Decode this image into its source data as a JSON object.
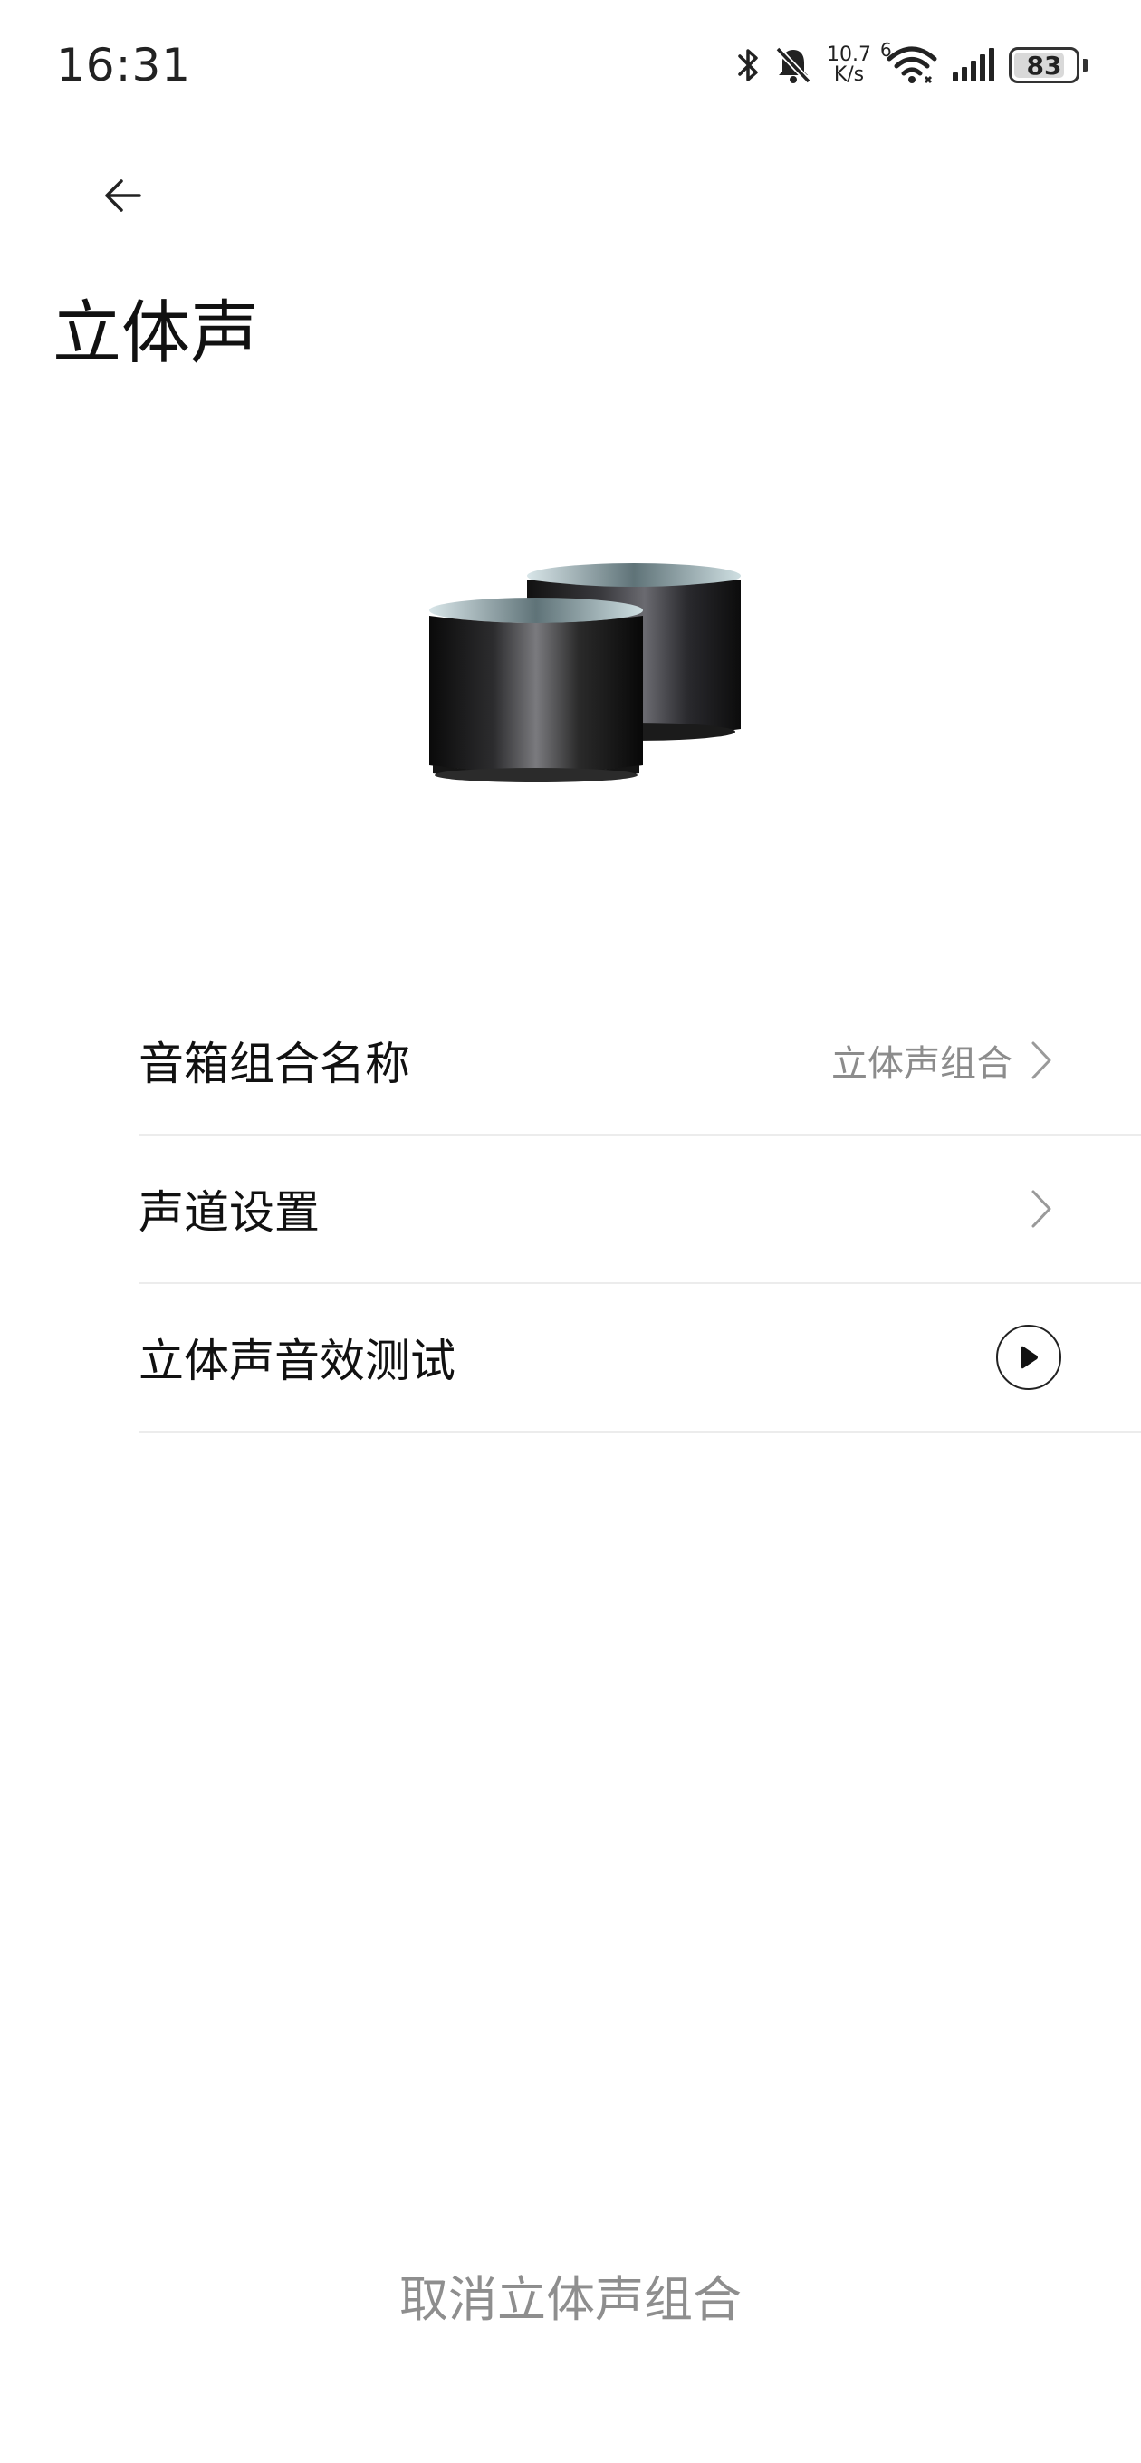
{
  "status_bar": {
    "time": "16:31",
    "net_speed_value": "10.7",
    "net_speed_unit": "K/s",
    "wifi_generation": "6",
    "battery_level": "83",
    "battery_fraction": 0.83,
    "icons": [
      "bluetooth-icon",
      "bell-muted-icon",
      "wifi-icon",
      "signal-icon",
      "battery-icon"
    ]
  },
  "header": {
    "back_icon": "arrow-left-icon",
    "title": "立体声"
  },
  "hero": {
    "icon": "stereo-speakers-image"
  },
  "settings": {
    "items": [
      {
        "label": "音箱组合名称",
        "value": "立体声组合",
        "accessory": "chevron-right-icon"
      },
      {
        "label": "声道设置",
        "accessory": "chevron-right-icon"
      },
      {
        "label": "立体声音效测试",
        "accessory": "play-icon"
      }
    ]
  },
  "footer": {
    "cancel_label": "取消立体声组合"
  },
  "colors": {
    "background": "#ffffff",
    "primary_text": "#111111",
    "secondary_text": "#8c8c8c",
    "divider": "#ececec"
  }
}
